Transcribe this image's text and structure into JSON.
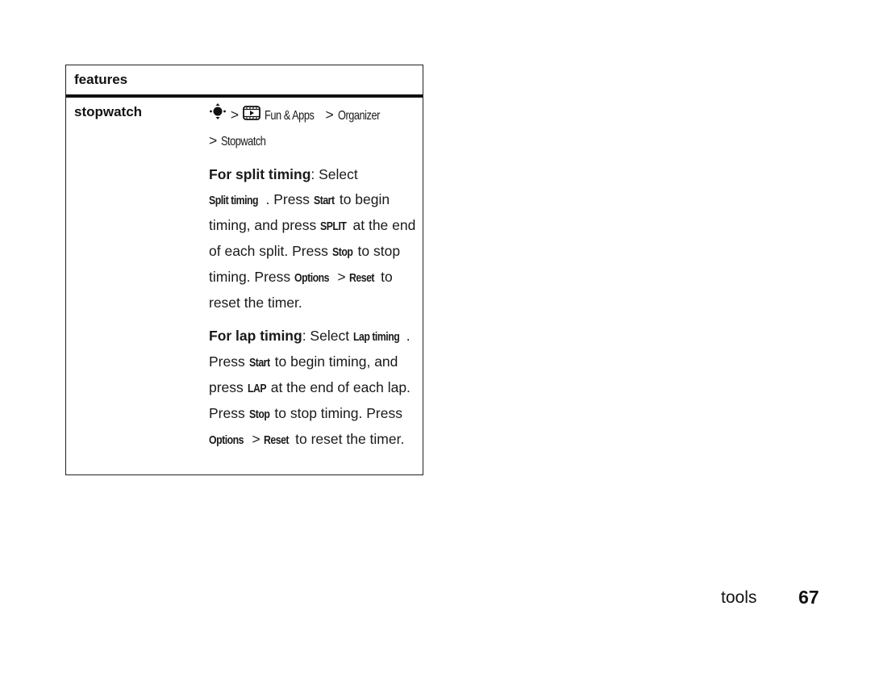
{
  "table": {
    "header": "features",
    "rows": [
      {
        "name": "stopwatch",
        "path": {
          "nav_icon": "nav-key-center-icon",
          "sep1": ">",
          "apps_icon": "fun-apps-icon",
          "item1": "Fun & Apps",
          "sep2": ">",
          "item2": "Organizer",
          "sep3": ">",
          "item3": "Stopwatch"
        },
        "split": {
          "title": "For split timing",
          "t1": ": Select ",
          "k1": "Split timing",
          "t2": ". Press ",
          "k2": "Start",
          "t3": " to begin timing, and press ",
          "k3": "SPLIT",
          "t4": " at the end of each split. Press ",
          "k4": "Stop",
          "t5": " to stop timing. Press ",
          "k5": "Options",
          "t6": " > ",
          "k6": "Reset",
          "t7": " to reset the timer."
        },
        "lap": {
          "title": "For lap timing",
          "t1": ": Select ",
          "k1": "Lap timing",
          "t2": ". Press ",
          "k2": "Start",
          "t3": " to begin timing, and press ",
          "k3": "LAP",
          "t4": " at the end of each lap. Press ",
          "k4": "Stop",
          "t5": " to stop timing. Press ",
          "k5": "Options",
          "t6": " > ",
          "k6": "Reset",
          "t7": " to reset the timer."
        }
      }
    ]
  },
  "footer": {
    "section": "tools",
    "page_number": "67"
  }
}
